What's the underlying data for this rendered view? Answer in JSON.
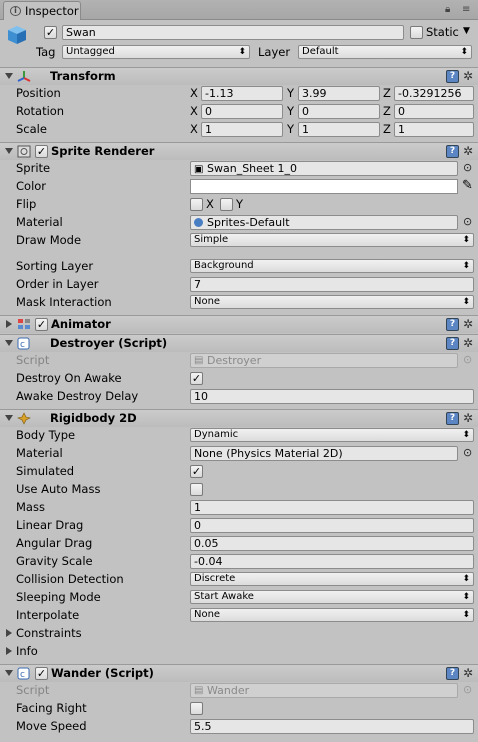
{
  "window": {
    "tab_title": "Inspector",
    "controls_icon": "lock-and-menu-icon"
  },
  "object": {
    "name": "Swan",
    "active": true,
    "static_label": "Static",
    "static": false,
    "tag_label": "Tag",
    "tag_value": "Untagged",
    "layer_label": "Layer",
    "layer_value": "Default",
    "icon": "gameobject-cube-icon"
  },
  "transform": {
    "title": "Transform",
    "position": {
      "label": "Position",
      "x": "-1.13",
      "y": "3.99",
      "z": "-0.3291256"
    },
    "rotation": {
      "label": "Rotation",
      "x": "0",
      "y": "0",
      "z": "0"
    },
    "scale": {
      "label": "Scale",
      "x": "1",
      "y": "1",
      "z": "1"
    },
    "axis": {
      "x": "X",
      "y": "Y",
      "z": "Z"
    }
  },
  "sprite_renderer": {
    "title": "Sprite Renderer",
    "enabled": true,
    "sprite_label": "Sprite",
    "sprite_value": "Swan_Sheet 1_0",
    "color_label": "Color",
    "color_value": "#ffffff",
    "flip_label": "Flip",
    "flip_x": "X",
    "flip_y": "Y",
    "material_label": "Material",
    "material_value": "Sprites-Default",
    "draw_mode_label": "Draw Mode",
    "draw_mode_value": "Simple",
    "sorting_layer_label": "Sorting Layer",
    "sorting_layer_value": "Background",
    "order_label": "Order in Layer",
    "order_value": "7",
    "mask_label": "Mask Interaction",
    "mask_value": "None"
  },
  "animator": {
    "title": "Animator",
    "enabled": true
  },
  "destroyer": {
    "title": "Destroyer (Script)",
    "script_label": "Script",
    "script_value": "Destroyer",
    "awake_label": "Destroy On Awake",
    "awake_checked": true,
    "delay_label": "Awake Destroy Delay",
    "delay_value": "10"
  },
  "rigidbody": {
    "title": "Rigidbody 2D",
    "body_type_label": "Body Type",
    "body_type_value": "Dynamic",
    "material_label": "Material",
    "material_value": "None (Physics Material 2D)",
    "simulated_label": "Simulated",
    "simulated_checked": true,
    "auto_mass_label": "Use Auto Mass",
    "auto_mass_checked": false,
    "mass_label": "Mass",
    "mass_value": "1",
    "linear_drag_label": "Linear Drag",
    "linear_drag_value": "0",
    "angular_drag_label": "Angular Drag",
    "angular_drag_value": "0.05",
    "gravity_label": "Gravity Scale",
    "gravity_value": "-0.04",
    "collision_label": "Collision Detection",
    "collision_value": "Discrete",
    "sleeping_label": "Sleeping Mode",
    "sleeping_value": "Start Awake",
    "interpolate_label": "Interpolate",
    "interpolate_value": "None",
    "constraints_label": "Constraints",
    "info_label": "Info"
  },
  "wander": {
    "title": "Wander (Script)",
    "enabled": true,
    "script_label": "Script",
    "script_value": "Wander",
    "facing_label": "Facing Right",
    "facing_checked": false,
    "speed_label": "Move Speed",
    "speed_value": "5.5"
  },
  "glyphs": {
    "check": "✓",
    "caret": "⬍",
    "gear": "✲",
    "help": "?",
    "target": "⊙"
  }
}
